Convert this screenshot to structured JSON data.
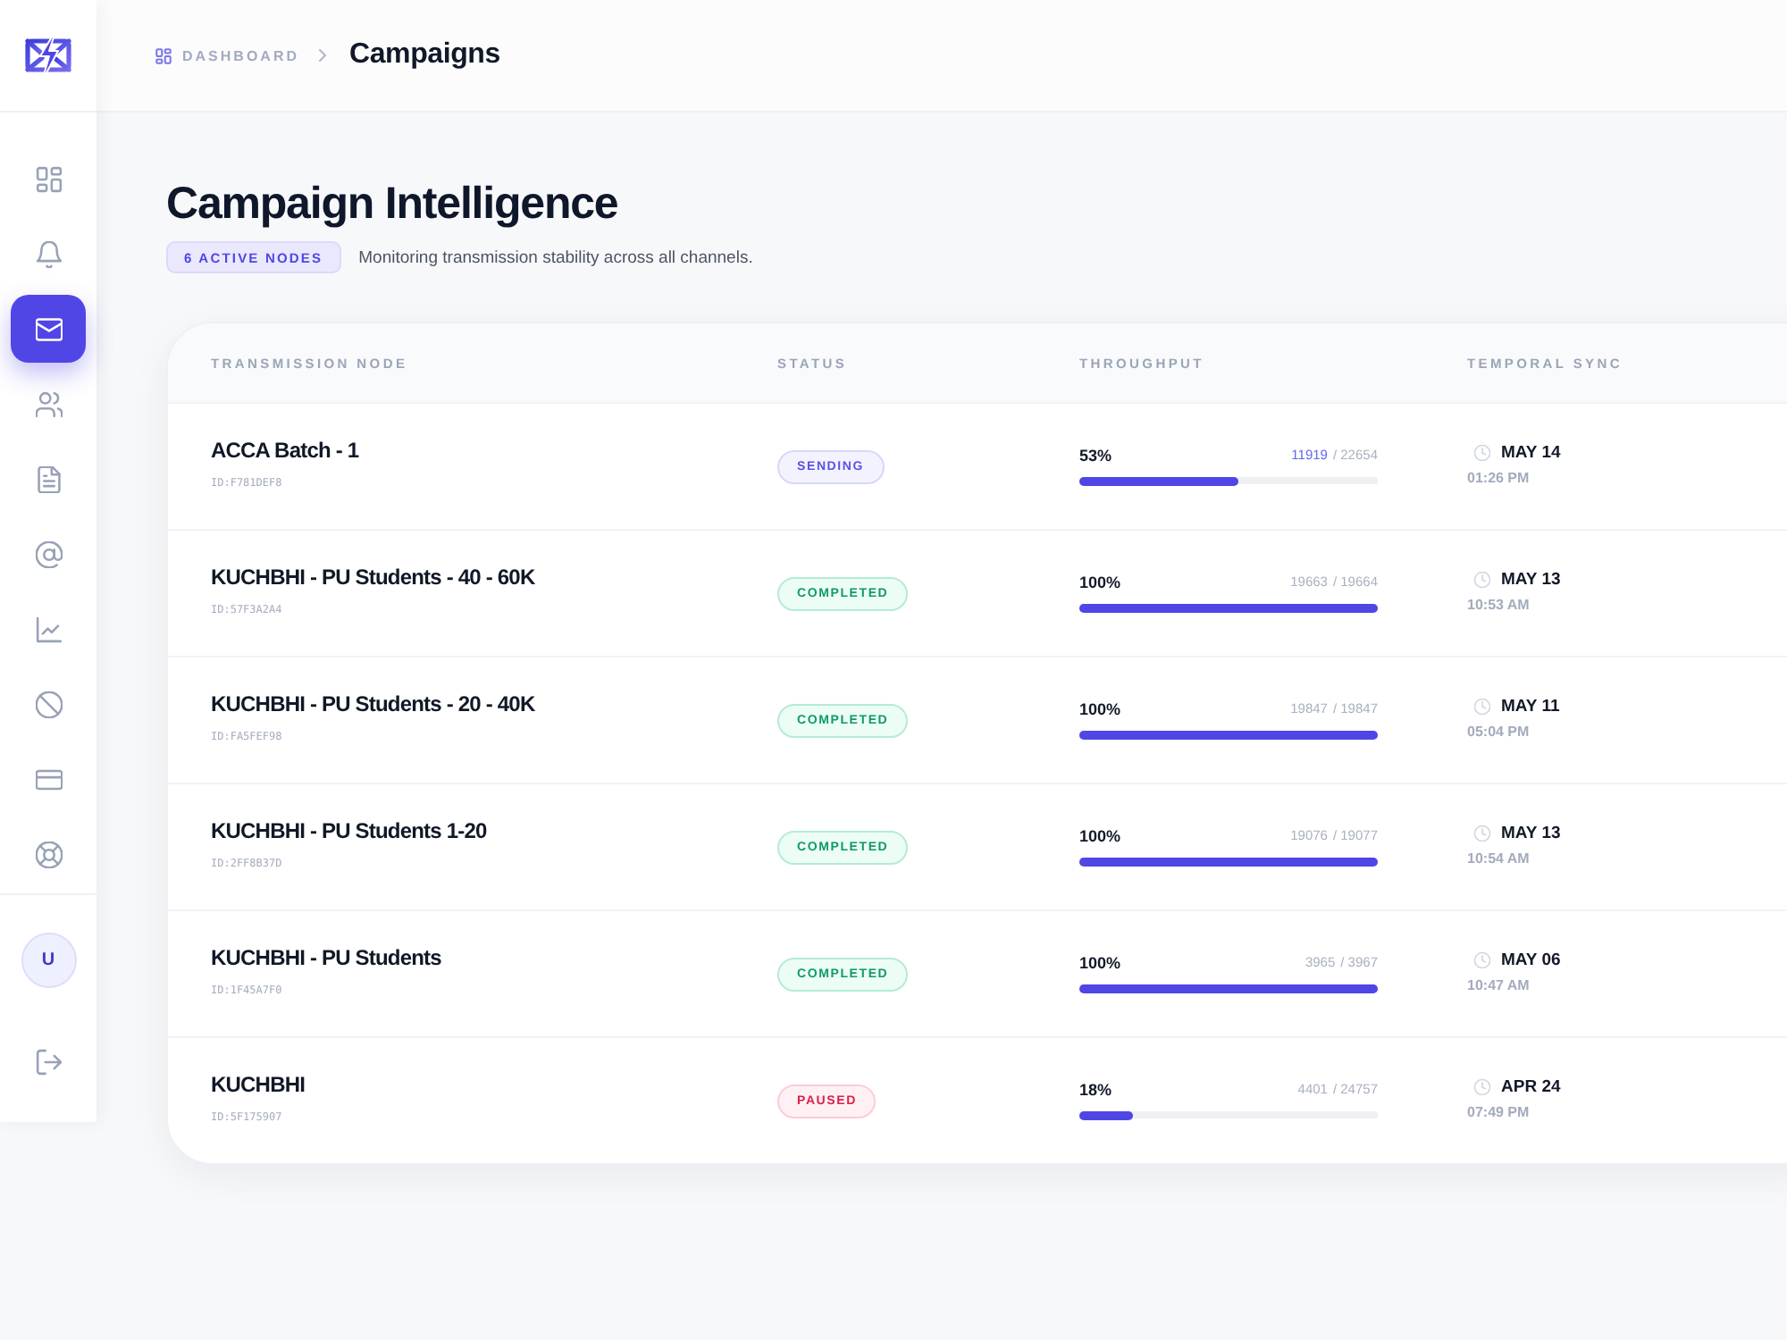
{
  "sidebar": {
    "items": [
      {
        "kind": "grid",
        "selected": false
      },
      {
        "kind": "bell",
        "selected": false
      },
      {
        "kind": "mail",
        "selected": true
      },
      {
        "kind": "users",
        "selected": false
      },
      {
        "kind": "document",
        "selected": false
      },
      {
        "kind": "at",
        "selected": false
      },
      {
        "kind": "chart",
        "selected": false
      },
      {
        "kind": "ban",
        "selected": false
      },
      {
        "kind": "card",
        "selected": false
      },
      {
        "kind": "lifebuoy",
        "selected": false
      }
    ],
    "avatar": "U"
  },
  "breadcrumb": {
    "parent": "DASHBOARD",
    "current": "Campaigns"
  },
  "page": {
    "title": "Campaign Intelligence",
    "badge": "6 ACTIVE NODES",
    "subtitle": "Monitoring transmission stability across all channels."
  },
  "table": {
    "columns": [
      "TRANSMISSION NODE",
      "STATUS",
      "THROUGHPUT",
      "TEMPORAL SYNC"
    ],
    "rows": [
      {
        "name": "ACCA Batch - 1",
        "id": "ID:F781DEF8",
        "status": {
          "label": "SENDING",
          "kind": "sending"
        },
        "percent": "53%",
        "sent": "11919",
        "total": "/ 22654",
        "level": 0.53,
        "date": "MAY 14",
        "time": "01:26 PM"
      },
      {
        "name": "KUCHBHI - PU Students - 40 - 60K",
        "id": "ID:57F3A2A4",
        "status": {
          "label": "COMPLETED",
          "kind": "completed"
        },
        "percent": "100%",
        "sent": "19663",
        "total": "/ 19664",
        "level": 1,
        "date": "MAY 13",
        "time": "10:53 AM"
      },
      {
        "name": "KUCHBHI - PU Students - 20 - 40K",
        "id": "ID:FA5FEF98",
        "status": {
          "label": "COMPLETED",
          "kind": "completed"
        },
        "percent": "100%",
        "sent": "19847",
        "total": "/ 19847",
        "level": 1,
        "date": "MAY 11",
        "time": "05:04 PM"
      },
      {
        "name": "KUCHBHI - PU Students 1-20",
        "id": "ID:2FF8B37D",
        "status": {
          "label": "COMPLETED",
          "kind": "completed"
        },
        "percent": "100%",
        "sent": "19076",
        "total": "/ 19077",
        "level": 1,
        "date": "MAY 13",
        "time": "10:54 AM"
      },
      {
        "name": "KUCHBHI - PU Students",
        "id": "ID:1F45A7F0",
        "status": {
          "label": "COMPLETED",
          "kind": "completed"
        },
        "percent": "100%",
        "sent": "3965",
        "total": "/ 3967",
        "level": 1,
        "date": "MAY 06",
        "time": "10:47 AM"
      },
      {
        "name": "KUCHBHI",
        "id": "ID:5F175907",
        "status": {
          "label": "PAUSED",
          "kind": "paused"
        },
        "percent": "18%",
        "sent": "4401",
        "total": "/ 24757",
        "level": 0.18,
        "date": "APR 24",
        "time": "07:49 PM"
      }
    ]
  }
}
